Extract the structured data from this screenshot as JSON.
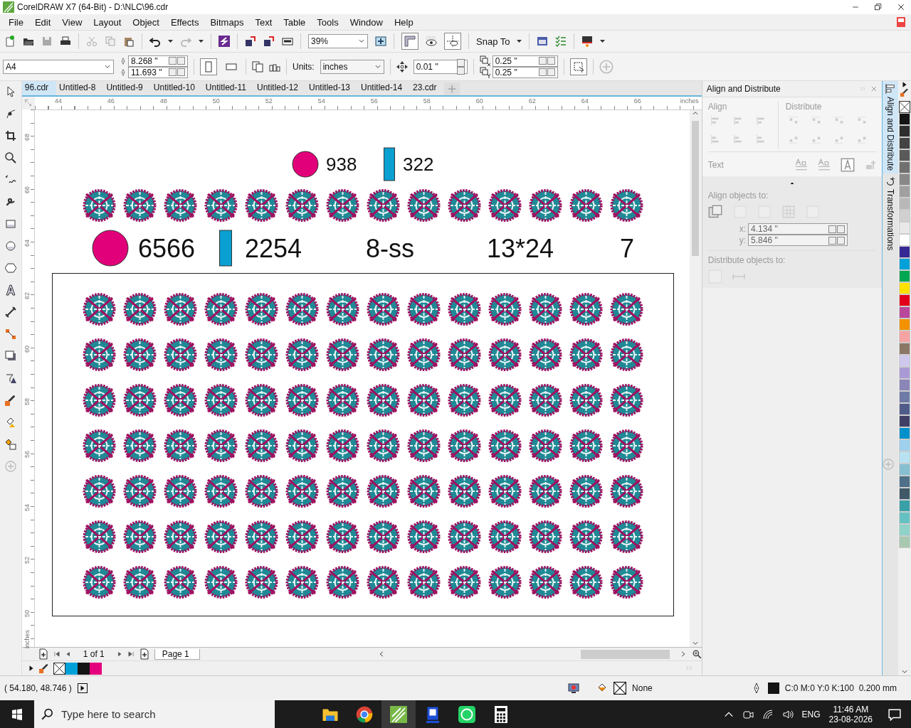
{
  "window": {
    "title": "CorelDRAW X7 (64-Bit) - D:\\NLC\\96.cdr"
  },
  "menu": [
    "File",
    "Edit",
    "View",
    "Layout",
    "Object",
    "Effects",
    "Bitmaps",
    "Text",
    "Table",
    "Tools",
    "Window",
    "Help"
  ],
  "standard_toolbar": {
    "zoom": "39%",
    "snap_to": "Snap To"
  },
  "property_bar": {
    "page_size": "A4",
    "width": "8.268 \"",
    "height": "11.693 \"",
    "orientation": [
      {
        "kind": "portrait",
        "selected": true
      },
      {
        "kind": "landscape",
        "selected": false
      }
    ],
    "units_label": "Units:",
    "units": "inches",
    "nudge": "0.01 \"",
    "duplicate_x": "0.25 \"",
    "duplicate_y": "0.25 \""
  },
  "document_tabs": [
    {
      "label": "96.cdr",
      "selected": true
    },
    {
      "label": "Untitled-8",
      "selected": false
    },
    {
      "label": "Untitled-9",
      "selected": false
    },
    {
      "label": "Untitled-10",
      "selected": false
    },
    {
      "label": "Untitled-11",
      "selected": false
    },
    {
      "label": "Untitled-12",
      "selected": false
    },
    {
      "label": "Untitled-13",
      "selected": false
    },
    {
      "label": "Untitled-14",
      "selected": false
    },
    {
      "label": "23.cdr",
      "selected": false
    }
  ],
  "rulers": {
    "horizontal": [
      "44",
      "46",
      "48",
      "50",
      "52",
      "54",
      "56",
      "58",
      "60",
      "62",
      "64",
      "66"
    ],
    "horizontal_unit": "inches",
    "vertical": [
      "68",
      "66",
      "64",
      "62",
      "60",
      "58",
      "56",
      "54",
      "52",
      "50"
    ],
    "vertical_unit": "inches"
  },
  "canvas": {
    "legend": [
      {
        "kind": "circle",
        "label": "938",
        "color": "#e2007a"
      },
      {
        "kind": "bar",
        "label": "322",
        "color": "#0aa0d2"
      }
    ],
    "specs": [
      {
        "kind": "circle",
        "label": "6566",
        "color": "#e2007a"
      },
      {
        "kind": "bar",
        "label": "2254",
        "color": "#0aa0d2"
      },
      {
        "kind": "text",
        "label": "8-ss"
      },
      {
        "kind": "text",
        "label": "13*24"
      },
      {
        "kind": "text",
        "label": "7"
      }
    ]
  },
  "page_nav": {
    "page_count": "1 of 1",
    "page_tab": "Page 1"
  },
  "document_palette": [
    {
      "kind": "none"
    },
    {
      "kind": "swatch",
      "color": "#00a0d8"
    },
    {
      "kind": "swatch",
      "color": "#141414"
    },
    {
      "kind": "swatch",
      "color": "#e4007c"
    }
  ],
  "docker": {
    "title": "Align and Distribute",
    "align": "Align",
    "distribute": "Distribute",
    "text": "Text",
    "align_objects_to": "Align objects to:",
    "x_label": "x:",
    "x": "4.134 \"",
    "y_label": "y:",
    "y": "5.846 \"",
    "distribute_objects_to": "Distribute objects to:"
  },
  "docker_tabs": [
    {
      "label": "Align and Distribute",
      "selected": true
    },
    {
      "label": "Transformations",
      "selected": false
    }
  ],
  "color_palette": [
    {
      "kind": "none"
    },
    {
      "kind": "swatch",
      "color": "#141414"
    },
    {
      "kind": "swatch",
      "color": "#2e2e2e"
    },
    {
      "kind": "swatch",
      "color": "#444444"
    },
    {
      "kind": "swatch",
      "color": "#5a5a5a"
    },
    {
      "kind": "swatch",
      "color": "#707070"
    },
    {
      "kind": "swatch",
      "color": "#888888"
    },
    {
      "kind": "swatch",
      "color": "#a0a0a0"
    },
    {
      "kind": "swatch",
      "color": "#b8b8b8"
    },
    {
      "kind": "swatch",
      "color": "#d0d0d0"
    },
    {
      "kind": "swatch",
      "color": "#e8e8e8"
    },
    {
      "kind": "swatch",
      "color": "#ffffff"
    },
    {
      "kind": "swatch",
      "color": "#352a94"
    },
    {
      "kind": "swatch",
      "color": "#00a0d8"
    },
    {
      "kind": "swatch",
      "color": "#00a651"
    },
    {
      "kind": "swatch",
      "color": "#ffe200"
    },
    {
      "kind": "swatch",
      "color": "#e2001a"
    },
    {
      "kind": "swatch",
      "color": "#b9479a"
    },
    {
      "kind": "swatch",
      "color": "#f39200"
    },
    {
      "kind": "swatch",
      "color": "#f5a3a3"
    },
    {
      "kind": "swatch",
      "color": "#8b7766"
    },
    {
      "kind": "swatch",
      "color": "#cfc8ee"
    },
    {
      "kind": "swatch",
      "color": "#a99ad6"
    },
    {
      "kind": "swatch",
      "color": "#8a86b8"
    },
    {
      "kind": "swatch",
      "color": "#6f7aa6"
    },
    {
      "kind": "swatch",
      "color": "#4f5c8a"
    },
    {
      "kind": "swatch",
      "color": "#3f3f66"
    },
    {
      "kind": "swatch",
      "color": "#0090cc"
    },
    {
      "kind": "swatch",
      "color": "#9fd0ee"
    },
    {
      "kind": "swatch",
      "color": "#b8e2f2"
    },
    {
      "kind": "swatch",
      "color": "#86bfd0"
    },
    {
      "kind": "swatch",
      "color": "#4f7088"
    },
    {
      "kind": "swatch",
      "color": "#405868"
    },
    {
      "kind": "swatch",
      "color": "#3aa0a8"
    },
    {
      "kind": "swatch",
      "color": "#66c2c2"
    },
    {
      "kind": "swatch",
      "color": "#8ed2c8"
    },
    {
      "kind": "swatch",
      "color": "#a8c8b0"
    }
  ],
  "status_bar": {
    "coordinates": "( 54.180, 48.746 )",
    "fill": "None",
    "outline": "C:0 M:0 Y:0 K:100  0.200 mm"
  },
  "taskbar": {
    "search_placeholder": "Type here to search",
    "language": "ENG",
    "time": "11:46 AM",
    "date": "23-08-2026"
  }
}
